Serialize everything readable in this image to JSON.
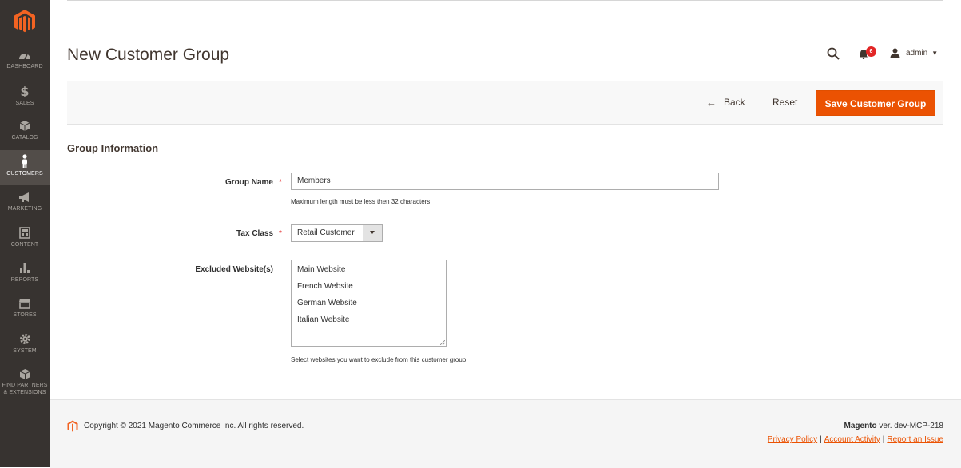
{
  "sidebar": {
    "items": [
      {
        "label": "Dashboard",
        "icon": "dashboard-icon"
      },
      {
        "label": "Sales",
        "icon": "dollar-icon"
      },
      {
        "label": "Catalog",
        "icon": "box-icon"
      },
      {
        "label": "Customers",
        "icon": "person-icon",
        "active": true
      },
      {
        "label": "Marketing",
        "icon": "megaphone-icon"
      },
      {
        "label": "Content",
        "icon": "layout-icon"
      },
      {
        "label": "Reports",
        "icon": "bar-chart-icon"
      },
      {
        "label": "Stores",
        "icon": "store-icon"
      },
      {
        "label": "System",
        "icon": "gear-icon"
      },
      {
        "label": "Find Partners",
        "label2": "& Extensions",
        "icon": "package-icon"
      }
    ]
  },
  "header": {
    "title": "New Customer Group",
    "notification_count": "6",
    "user": "admin"
  },
  "actions": {
    "back_label": "Back",
    "reset_label": "Reset",
    "save_label": "Save Customer Group"
  },
  "form": {
    "section_title": "Group Information",
    "group_name": {
      "label": "Group Name",
      "value": "Members",
      "note": "Maximum length must be less then 32 characters."
    },
    "tax_class": {
      "label": "Tax Class",
      "value": "Retail Customer"
    },
    "excluded_websites": {
      "label": "Excluded Website(s)",
      "options": [
        "Main Website",
        "French Website",
        "German Website",
        "Italian Website"
      ],
      "note": "Select websites you want to exclude from this customer group."
    }
  },
  "footer": {
    "copyright": "Copyright © 2021 Magento Commerce Inc. All rights reserved.",
    "brand": "Magento",
    "version": " ver. dev-MCP-218",
    "links": [
      "Privacy Policy",
      "Account Activity",
      "Report an Issue"
    ]
  },
  "colors": {
    "accent": "#eb5202",
    "sidebar_bg": "#373330",
    "sidebar_active": "#524d49"
  }
}
